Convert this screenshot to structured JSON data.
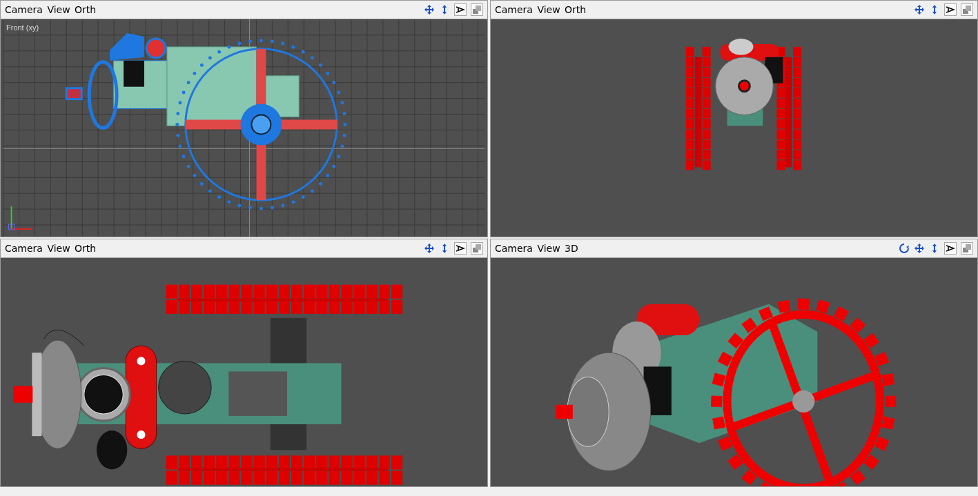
{
  "viewports": [
    {
      "title": "Camera View Orth",
      "kind": "wireframe",
      "view_label": "Front (xy)",
      "orbit_tool": false
    },
    {
      "title": "Camera View Orth",
      "kind": "front",
      "orbit_tool": false
    },
    {
      "title": "Camera View Orth",
      "kind": "top",
      "orbit_tool": false
    },
    {
      "title": "Camera View 3D",
      "kind": "perspective",
      "orbit_tool": true
    }
  ]
}
